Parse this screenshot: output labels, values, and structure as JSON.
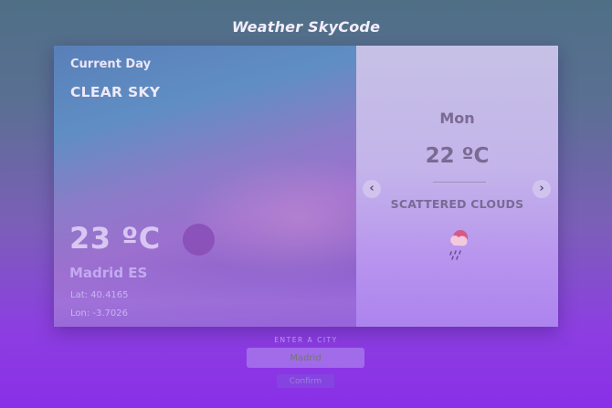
{
  "app": {
    "title": "Weather SkyCode"
  },
  "current": {
    "heading": "Current Day",
    "condition": "CLEAR SKY",
    "temperature": "23 ºC",
    "location": "Madrid ES",
    "lat": "Lat: 40.4165",
    "lon": "Lon: -3.7026",
    "icon": "sun-disc-icon"
  },
  "forecast": {
    "day": "Mon",
    "temperature": "22 ºC",
    "condition": "SCATTERED CLOUDS",
    "icon": "cloud-rain-icon",
    "prev_label": "‹",
    "next_label": "›"
  },
  "search": {
    "label": "ENTER A CITY",
    "placeholder": "Madrid",
    "button_label": "Confirm"
  },
  "colors": {
    "accent": "#8a2fe8",
    "card_right": "#c6c1e6",
    "text_muted": "#7a6a94"
  }
}
